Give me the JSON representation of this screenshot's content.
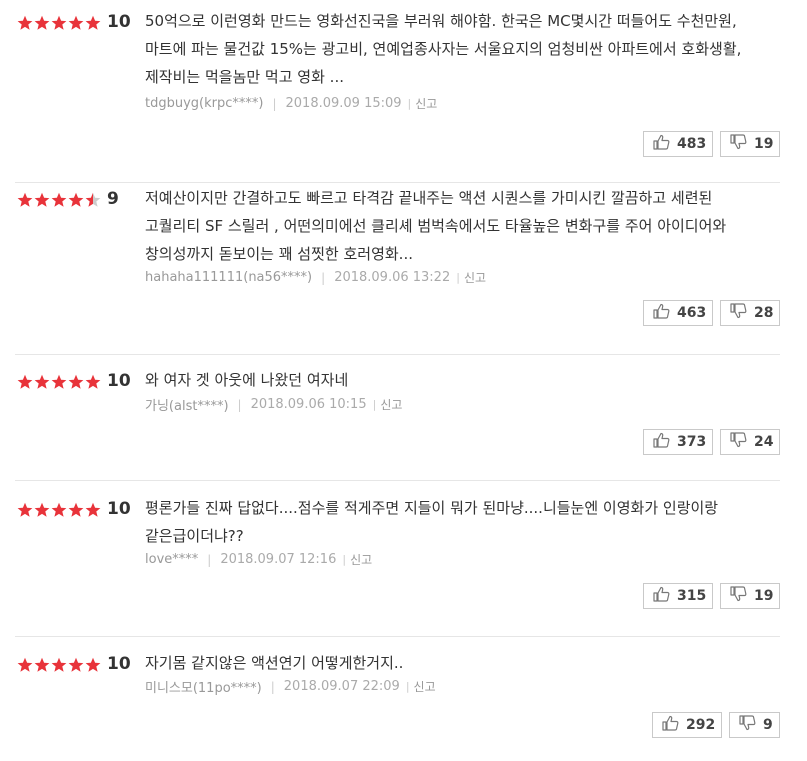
{
  "reviews": [
    {
      "rating": 5,
      "score": "10",
      "text": "50억으로 이런영화 만드는 영화선진국을 부러워 해야함. 한국은 MC몇시간 떠들어도 수천만원, 마트에 파는 물건값 15%는 광고비, 연예업종사자는 서울요지의 엄청비싼 아파트에서 호화생활, 제작비는 먹을놈만 먹고 영화 ...",
      "user": "tdgbuyg(krpc****)",
      "datetime": "2018.09.09 15:09",
      "report": "신고",
      "likes": "483",
      "dislikes": "19"
    },
    {
      "rating": 4.5,
      "score": "9",
      "text": "저예산이지만 간결하고도 빠르고 타격감 끝내주는 액션 시퀀스를 가미시킨 깔끔하고 세련된 고퀄리티 SF 스릴러 , 어떤의미에선 클리셰 범벅속에서도 타율높은 변화구를 주어 아이디어와 창의성까지 돋보이는 꽤 섬찟한 호러영화...",
      "user": "hahaha111111(na56****)",
      "datetime": "2018.09.06 13:22",
      "report": "신고",
      "likes": "463",
      "dislikes": "28"
    },
    {
      "rating": 5,
      "score": "10",
      "text": "와 여자 겟 아웃에 나왔던 여자네",
      "user": "가닝(alst****)",
      "datetime": "2018.09.06 10:15",
      "report": "신고",
      "likes": "373",
      "dislikes": "24"
    },
    {
      "rating": 5,
      "score": "10",
      "text": "평론가들 진짜 답없다....점수를 적게주면 지들이 뭐가 된마냥....니들눈엔 이영화가 인랑이랑 같은급이더냐??",
      "user": "love****",
      "datetime": "2018.09.07 12:16",
      "report": "신고",
      "likes": "315",
      "dislikes": "19"
    },
    {
      "rating": 5,
      "score": "10",
      "text": "자기몸 같지않은 액션연기 어떻게한거지..",
      "user": "미니스모(11po****)",
      "datetime": "2018.09.07 22:09",
      "report": "신고",
      "likes": "292",
      "dislikes": "9"
    }
  ],
  "colors": {
    "star": "#e8333a",
    "star_empty": "#cccccc",
    "meta": "#999999"
  },
  "icons": {
    "like": "thumbs-up-icon",
    "dislike": "thumbs-down-icon",
    "star": "star-icon"
  }
}
